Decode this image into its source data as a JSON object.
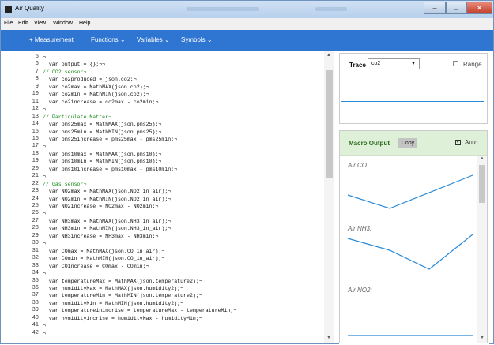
{
  "window": {
    "title": "Air Quality"
  },
  "menu": [
    "File",
    "Edit",
    "View",
    "Window",
    "Help"
  ],
  "toolbar": {
    "measurement": "+ Measurement",
    "functions": "Functions ⌄",
    "variables": "Variables ⌄",
    "symbols": "Symbols ⌄"
  },
  "editor": {
    "lines": [
      {
        "n": "5",
        "t": "¬",
        "c": false
      },
      {
        "n": "6",
        "t": "  var output = {};¬¬",
        "c": false
      },
      {
        "n": "7",
        "t": "// CO2 sensor¬",
        "c": true
      },
      {
        "n": "8",
        "t": "  var co2produced = json.co2;¬",
        "c": false
      },
      {
        "n": "9",
        "t": "  var co2max = MathMAX(json.co2);¬",
        "c": false
      },
      {
        "n": "10",
        "t": "  var co2min = MathMIN(json.co2);¬",
        "c": false
      },
      {
        "n": "11",
        "t": "  var co2increase = co2max - co2min;¬",
        "c": false
      },
      {
        "n": "12",
        "t": "¬",
        "c": false
      },
      {
        "n": "13",
        "t": "// Particulate Matter¬",
        "c": true
      },
      {
        "n": "14",
        "t": "  var pms25max = MathMAX(json.pms25);¬",
        "c": false
      },
      {
        "n": "15",
        "t": "  var pms25min = MathMIN(json.pms25);¬",
        "c": false
      },
      {
        "n": "16",
        "t": "  var pms25increase = pms25max - pms25min;¬",
        "c": false
      },
      {
        "n": "17",
        "t": "¬",
        "c": false
      },
      {
        "n": "18",
        "t": "  var pms10max = MathMAX(json.pms10);¬",
        "c": false
      },
      {
        "n": "19",
        "t": "  var pms10min = MathMIN(json.pms10);¬",
        "c": false
      },
      {
        "n": "20",
        "t": "  var pms10increase = pms10max - pms10min;¬",
        "c": false
      },
      {
        "n": "21",
        "t": "¬",
        "c": false
      },
      {
        "n": "22",
        "t": "// Gas sensor¬",
        "c": true
      },
      {
        "n": "23",
        "t": "  var NO2max = MathMAX(json.NO2_in_air);¬",
        "c": false
      },
      {
        "n": "24",
        "t": "  var NO2min = MathMIN(json.NO2_in_air);¬",
        "c": false
      },
      {
        "n": "25",
        "t": "  var NO2increase = NO2max - NO2min;¬",
        "c": false
      },
      {
        "n": "26",
        "t": "¬",
        "c": false
      },
      {
        "n": "27",
        "t": "  var NH3max = MathMAX(json.NH3_in_air);¬",
        "c": false
      },
      {
        "n": "28",
        "t": "  var NH3min = MathMIN(json.NH3_in_air);¬",
        "c": false
      },
      {
        "n": "29",
        "t": "  var NH3increase = NH3max - NH3min;¬",
        "c": false
      },
      {
        "n": "30",
        "t": "¬",
        "c": false
      },
      {
        "n": "31",
        "t": "  var COmax = MathMAX(json.CO_in_air);¬",
        "c": false
      },
      {
        "n": "32",
        "t": "  var COmin = MathMIN(json.CO_in_air);¬",
        "c": false
      },
      {
        "n": "33",
        "t": "  var COincrease = COmax - COmin;¬",
        "c": false
      },
      {
        "n": "34",
        "t": "¬",
        "c": false
      },
      {
        "n": "35",
        "t": "  var temperatureMax = MathMAX(json.temperature2);¬",
        "c": false
      },
      {
        "n": "36",
        "t": "  var humidityMax = MathMAX(json.humidity2);¬",
        "c": false
      },
      {
        "n": "37",
        "t": "  var temperatureMin = MathMIN(json.temperature2);¬",
        "c": false
      },
      {
        "n": "38",
        "t": "  var humidityMin = MathMIN(json.humidity2);¬",
        "c": false
      },
      {
        "n": "39",
        "t": "  var temperatureinincrise = temperatureMax - temperatureMin;¬",
        "c": false
      },
      {
        "n": "40",
        "t": "  var hymidityincrise = humidityMax - humidityMin;¬",
        "c": false
      },
      {
        "n": "41",
        "t": "¬",
        "c": false
      },
      {
        "n": "42",
        "t": "¬",
        "c": false
      }
    ]
  },
  "trace": {
    "label": "Trace",
    "selected": "co2",
    "range_label": "Range",
    "range_checked": false
  },
  "macro": {
    "title": "Macro Output",
    "copy_label": "Copy",
    "auto_label": "Auto",
    "auto_checked": true,
    "charts": [
      {
        "label": "Air CO:"
      },
      {
        "label": "Air NH3:"
      },
      {
        "label": "Air NO2:"
      }
    ]
  },
  "colors": {
    "toolbar": "#2f76d2",
    "macro_header": "#dff0d8",
    "line": "#2b8ad6",
    "comment": "#1c8c1c"
  }
}
